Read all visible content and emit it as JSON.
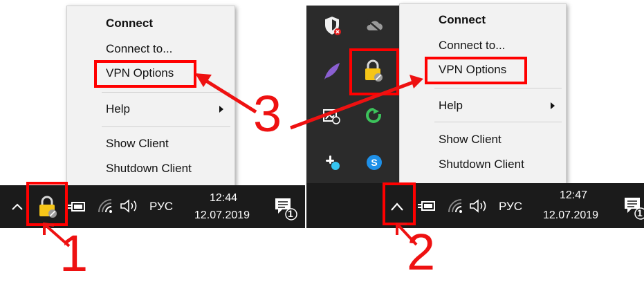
{
  "left_panel": {
    "menu": {
      "items": [
        {
          "label": "Connect",
          "bold": true
        },
        {
          "label": "Connect to...",
          "bold": false
        },
        {
          "label": "VPN Options",
          "bold": false
        },
        {
          "label": "Help",
          "bold": false,
          "submenu": true
        },
        {
          "label": "Show Client",
          "bold": false
        },
        {
          "label": "Shutdown Client",
          "bold": false
        }
      ]
    },
    "taskbar": {
      "lang": "РУС",
      "time": "12:44",
      "date": "12.07.2019",
      "notification_count": "1"
    }
  },
  "right_panel": {
    "menu": {
      "items": [
        {
          "label": "Connect",
          "bold": true
        },
        {
          "label": "Connect to...",
          "bold": false
        },
        {
          "label": "VPN Options",
          "bold": false
        },
        {
          "label": "Help",
          "bold": false,
          "submenu": true
        },
        {
          "label": "Show Client",
          "bold": false
        },
        {
          "label": "Shutdown Client",
          "bold": false
        }
      ]
    },
    "taskbar": {
      "lang": "РУС",
      "time": "12:47",
      "date": "12.07.2019",
      "notification_count": "1"
    }
  },
  "annotations": {
    "step1": "1",
    "step2": "2",
    "step3": "3"
  },
  "colors": {
    "highlight": "#ff0000",
    "taskbar": "#1b1b1b",
    "menu_bg": "#f2f2f2"
  }
}
